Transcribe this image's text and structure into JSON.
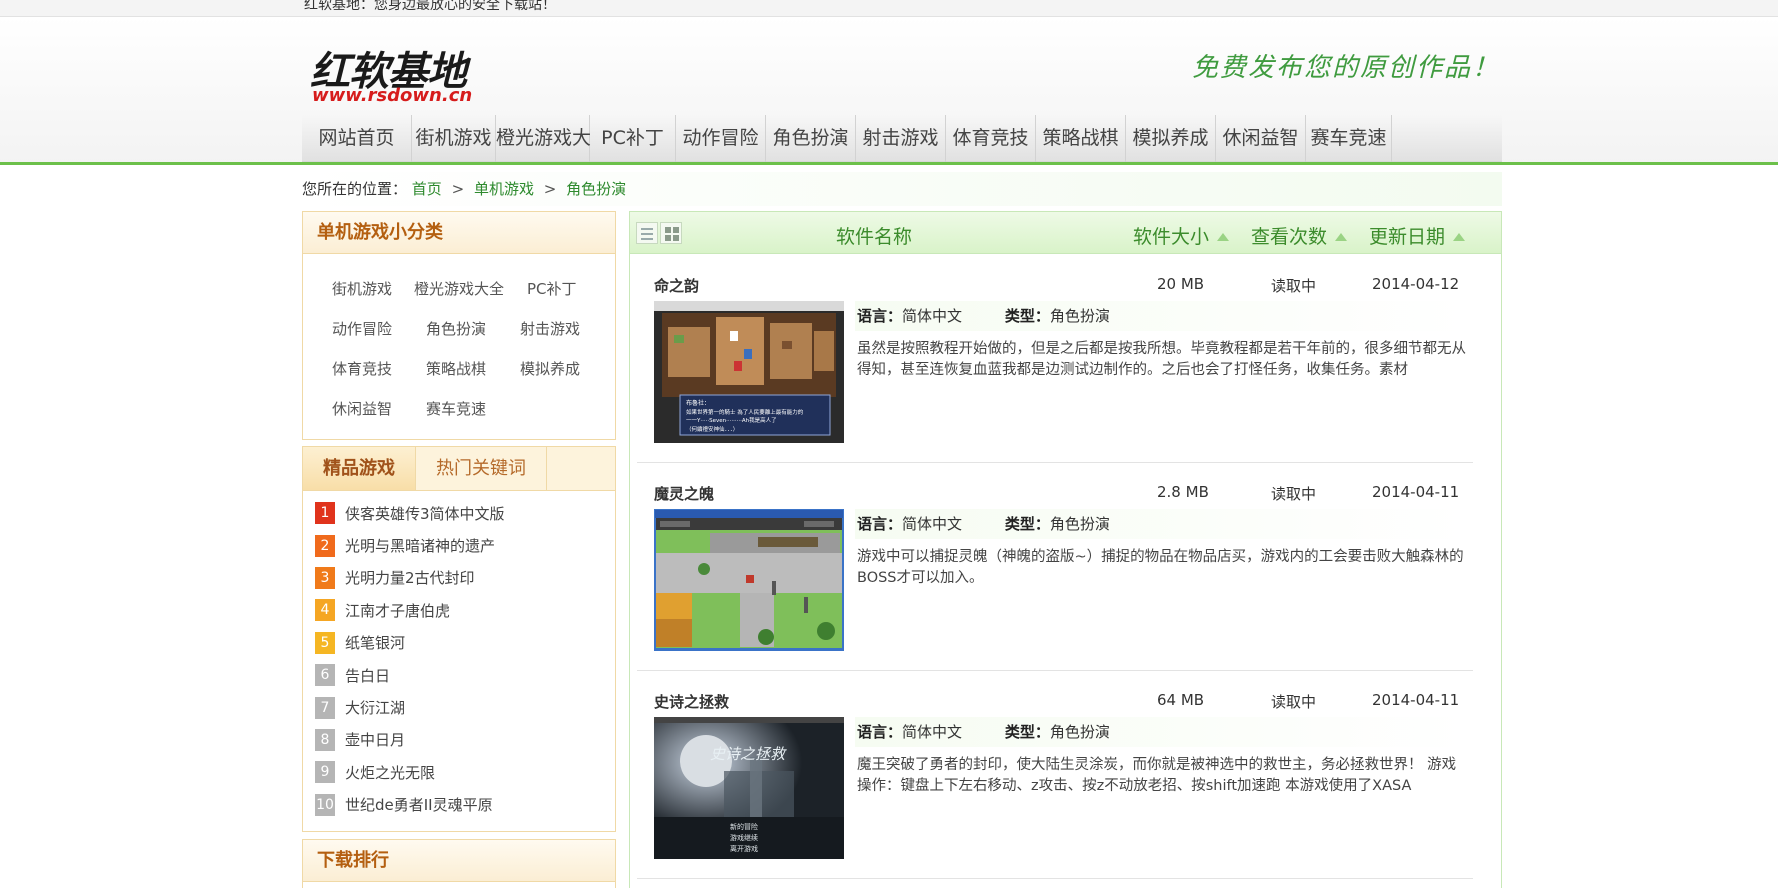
{
  "topbar": {
    "text": "红软基地：您身边最放心的安全下载站！"
  },
  "header": {
    "logo_cn": "红软基地",
    "logo_en": "www.rsdown.cn",
    "slogan": "免费发布您的原创作品！"
  },
  "nav": {
    "items": [
      "网站首页",
      "街机游戏",
      "橙光游戏大",
      "PC补丁",
      "动作冒险",
      "角色扮演",
      "射击游戏",
      "体育竞技",
      "策略战棋",
      "模拟养成",
      "休闲益智",
      "赛车竞速"
    ]
  },
  "breadcrumb": {
    "prefix": "您所在的位置：",
    "items": [
      "首页",
      "单机游戏",
      "角色扮演"
    ],
    "separator": ">"
  },
  "category_panel": {
    "title": "单机游戏小分类",
    "items": [
      "街机游戏",
      "橙光游戏大全",
      "PC补丁",
      "动作冒险",
      "角色扮演",
      "射击游戏",
      "体育竞技",
      "策略战棋",
      "模拟养成",
      "休闲益智",
      "赛车竞速"
    ]
  },
  "rank_panel": {
    "tabs": [
      "精品游戏",
      "热门关键词"
    ],
    "items": [
      {
        "num": "1",
        "title": "侠客英雄传3简体中文版",
        "color": "#e0331c"
      },
      {
        "num": "2",
        "title": "光明与黑暗诸神的遗产",
        "color": "#f06a1c"
      },
      {
        "num": "3",
        "title": "光明力量2古代封印",
        "color": "#f07a1a"
      },
      {
        "num": "4",
        "title": "江南才子唐伯虎",
        "color": "#f5a623"
      },
      {
        "num": "5",
        "title": "纸笔银河",
        "color": "#f5b623"
      },
      {
        "num": "6",
        "title": "告白日",
        "color": "#b5b5b5"
      },
      {
        "num": "7",
        "title": "大衍江湖",
        "color": "#b5b5b5"
      },
      {
        "num": "8",
        "title": "壶中日月",
        "color": "#b5b5b5"
      },
      {
        "num": "9",
        "title": "火炬之光无限",
        "color": "#b5b5b5"
      },
      {
        "num": "10",
        "title": "世纪de勇者II灵魂平原",
        "color": "#b5b5b5"
      }
    ]
  },
  "download_panel": {
    "title": "下载排行"
  },
  "list": {
    "header": {
      "name": "软件名称",
      "size": "软件大小",
      "views": "查看次数",
      "date": "更新日期"
    },
    "labels": {
      "language": "语言：",
      "type": "类型："
    },
    "entries": [
      {
        "name": "命之韵",
        "size": "20 MB",
        "views": "读取中",
        "date": "2014-04-12",
        "language": "简体中文",
        "type": "角色扮演",
        "desc": "虽然是按照教程开始做的，但是之后都是按我所想。毕竟教程都是若干年前的，很多细节都无从得知，甚至连恢复血蓝我都是边测试边制作的。之后也会了打怪任务，收集任务。素材"
      },
      {
        "name": "魔灵之魄",
        "size": "2.8 MB",
        "views": "读取中",
        "date": "2014-04-11",
        "language": "简体中文",
        "type": "角色扮演",
        "desc": "游戏中可以捕捉灵魄（神魄的盗版~）捕捉的物品在物品店买，游戏内的工会要击败大触森林的BOSS才可以加入。"
      },
      {
        "name": "史诗之拯救",
        "size": "64 MB",
        "views": "读取中",
        "date": "2014-04-11",
        "language": "简体中文",
        "type": "角色扮演",
        "desc": "魔王突破了勇者的封印，使大陆生灵涂炭，而你就是被神选中的救世主，务必拯救世界！ 游戏操作：键盘上下左右移动、z攻击、按z不动放老招、按shift加速跑 本游戏使用了XASA"
      }
    ]
  },
  "thumbs": {
    "dialog_lines": [
      "布魯社：",
      "如果世界第一的騎士 為了人民要離上最有能力的",
      "一一Y·····Seven·········Ah我是高人了",
      "（何續禮安神仙．．．）"
    ],
    "epic_title": "史诗之拯救",
    "epic_menu": [
      "新的冒险",
      "游戏继续",
      "离开游戏"
    ]
  },
  "colors": {
    "accent_green": "#6cc04a",
    "link_green": "#2e8a2e",
    "panel_orange": "#b45f10",
    "logo_red": "#d61c1c"
  }
}
